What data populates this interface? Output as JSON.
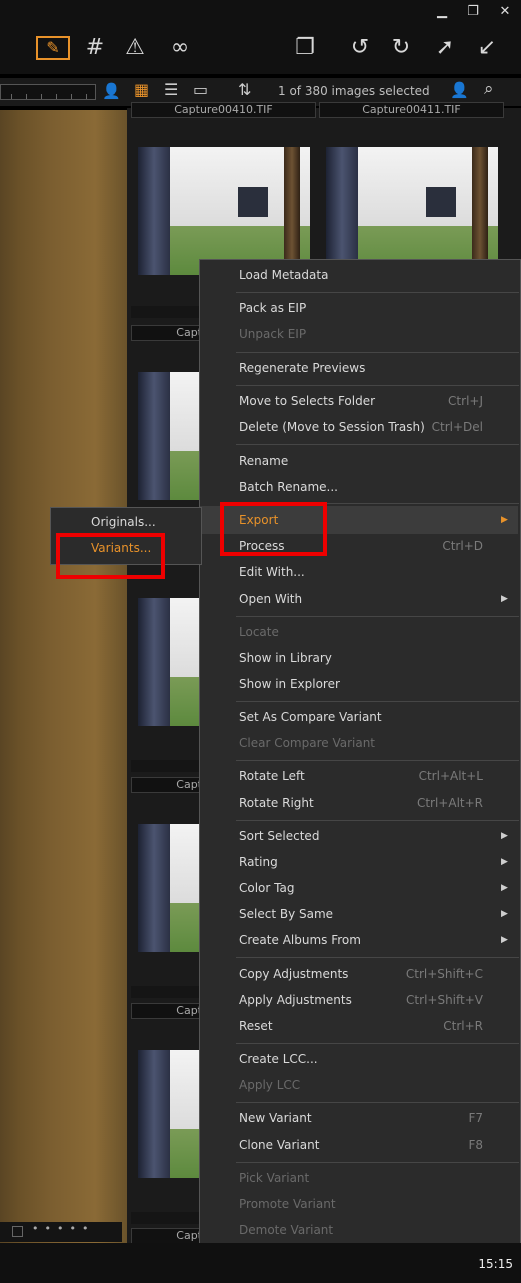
{
  "window_controls": {
    "minimize": "minimize-icon",
    "restore": "restore-icon",
    "close": "close-icon"
  },
  "toolbar_icons": [
    "edit-pencil-icon",
    "grid-icon",
    "warning-icon",
    "glasses-icon",
    "stack-icon",
    "rotate-left-icon",
    "rotate-right-icon",
    "expand-icon",
    "collapse-icon"
  ],
  "filter": {
    "count": "1 of 380 images selected"
  },
  "thumbnails": {
    "captions": [
      "Capture00410.TIF",
      "Capture00411.TIF",
      "Capt",
      "Capt",
      "Capt",
      "Capt"
    ]
  },
  "menu": {
    "load_metadata": "Load Metadata",
    "pack_eip": "Pack as EIP",
    "unpack_eip": "Unpack EIP",
    "regenerate": "Regenerate Previews",
    "move_selects": "Move to Selects Folder",
    "move_selects_sc": "Ctrl+J",
    "delete": "Delete (Move to Session Trash)",
    "delete_sc": "Ctrl+Del",
    "rename": "Rename",
    "batch_rename": "Batch Rename...",
    "export": "Export",
    "process": "Process",
    "process_sc": "Ctrl+D",
    "edit_with": "Edit With...",
    "open_with": "Open With",
    "locate": "Locate",
    "show_library": "Show in Library",
    "show_explorer": "Show in Explorer",
    "set_compare": "Set As Compare Variant",
    "clear_compare": "Clear Compare Variant",
    "rotate_left": "Rotate Left",
    "rotate_left_sc": "Ctrl+Alt+L",
    "rotate_right": "Rotate Right",
    "rotate_right_sc": "Ctrl+Alt+R",
    "sort_selected": "Sort Selected",
    "rating": "Rating",
    "color_tag": "Color Tag",
    "select_by_same": "Select By Same",
    "create_albums": "Create Albums From",
    "copy_adj": "Copy Adjustments",
    "copy_adj_sc": "Ctrl+Shift+C",
    "apply_adj": "Apply Adjustments",
    "apply_adj_sc": "Ctrl+Shift+V",
    "reset": "Reset",
    "reset_sc": "Ctrl+R",
    "create_lcc": "Create LCC...",
    "apply_lcc": "Apply LCC",
    "new_variant": "New Variant",
    "new_variant_sc": "F7",
    "clone_variant": "Clone Variant",
    "clone_variant_sc": "F8",
    "pick_variant": "Pick Variant",
    "promote_variant": "Promote Variant",
    "demote_variant": "Demote Variant"
  },
  "submenu": {
    "originals": "Originals...",
    "variants": "Variants..."
  },
  "taskbar": {
    "clock": "15:15"
  },
  "colors": {
    "accent": "#e8922a",
    "highlight_box": "#ee0000",
    "menu_bg": "#2b2b2b"
  }
}
